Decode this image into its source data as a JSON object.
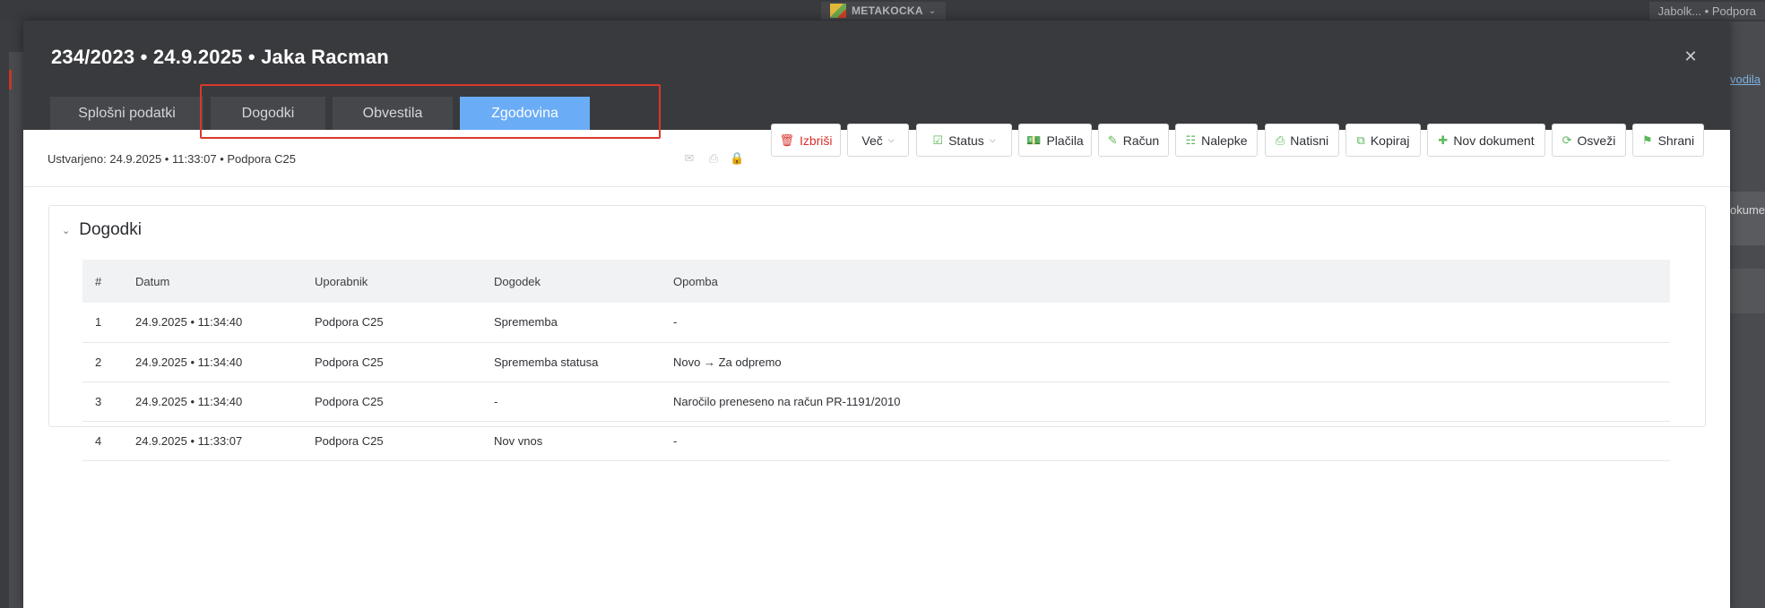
{
  "background": {
    "brand": "METAKOCKA",
    "user": "Jabolk... • Podpora",
    "right_link": "vodila",
    "right_text": "okume"
  },
  "modal": {
    "title": "234/2023 • 24.9.2025 • Jaka Racman",
    "close_icon": "close-icon",
    "tabs": [
      {
        "label": "Splošni podatki",
        "active": false
      },
      {
        "label": "Dogodki",
        "active": false
      },
      {
        "label": "Obvestila",
        "active": false
      },
      {
        "label": "Zgodovina",
        "active": true
      }
    ],
    "highlight_color": "#d9392d",
    "accent_color": "#6aacf5"
  },
  "toolbar": {
    "created": "Ustvarjeno: 24.9.2025 • 11:33:07 • Podpora C25",
    "buttons": [
      {
        "label": "Izbriši",
        "icon": "trash-icon",
        "color": "#d9302a"
      },
      {
        "label": "Več",
        "dropdown": true
      },
      {
        "label": "Status",
        "icon": "check-square-icon",
        "dropdown": true
      },
      {
        "label": "Plačila",
        "icon": "money-icon"
      },
      {
        "label": "Račun",
        "icon": "pencil-icon"
      },
      {
        "label": "Nalepke",
        "icon": "label-icon"
      },
      {
        "label": "Natisni",
        "icon": "printer-icon"
      },
      {
        "label": "Kopiraj",
        "icon": "copy-icon"
      },
      {
        "label": "Nov dokument",
        "icon": "plus-icon"
      },
      {
        "label": "Osveži",
        "icon": "refresh-icon"
      },
      {
        "label": "Shrani",
        "icon": "bookmark-icon"
      }
    ]
  },
  "events": {
    "title": "Dogodki",
    "columns": [
      "#",
      "Datum",
      "Uporabnik",
      "Dogodek",
      "Opomba"
    ],
    "rows": [
      [
        "1",
        "24.9.2025 • 11:34:40",
        "Podpora C25",
        "Sprememba",
        "-"
      ],
      [
        "2",
        "24.9.2025 • 11:34:40",
        "Podpora C25",
        "Sprememba statusa",
        "Novo → Za odpremo"
      ],
      [
        "3",
        "24.9.2025 • 11:34:40",
        "Podpora C25",
        "-",
        "Naročilo preneseno na račun PR-1191/2010"
      ],
      [
        "4",
        "24.9.2025 • 11:33:07",
        "Podpora C25",
        "Nov vnos",
        "-"
      ]
    ]
  }
}
